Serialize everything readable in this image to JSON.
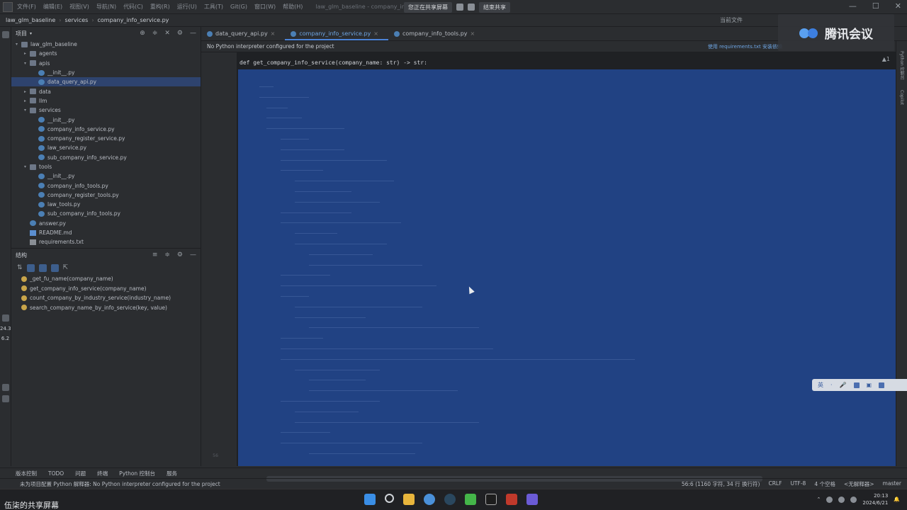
{
  "menubar": {
    "items": [
      "文件(F)",
      "编辑(E)",
      "视图(V)",
      "导航(N)",
      "代码(C)",
      "重构(R)",
      "运行(U)",
      "工具(T)",
      "Git(G)",
      "窗口(W)",
      "帮助(H)"
    ],
    "window_title": "law_glm_baseline - company_info_se",
    "share_pill": "您正在共享屏幕",
    "stop_share": "结束共享"
  },
  "navbar": {
    "project": "law_glm_baseline",
    "folder": "services",
    "file": "company_info_service.py",
    "run_config": "当前文件"
  },
  "project_panel": {
    "title": "项目",
    "tree": [
      {
        "label": "law_glm_baseline",
        "level": 0,
        "type": "folder",
        "expanded": true
      },
      {
        "label": "agents",
        "level": 1,
        "type": "folder",
        "expanded": false
      },
      {
        "label": "apis",
        "level": 1,
        "type": "folder",
        "expanded": true
      },
      {
        "label": "__init__.py",
        "level": 2,
        "type": "py"
      },
      {
        "label": "data_query_api.py",
        "level": 2,
        "type": "py",
        "selected": true
      },
      {
        "label": "data",
        "level": 1,
        "type": "folder",
        "expanded": false
      },
      {
        "label": "llm",
        "level": 1,
        "type": "folder",
        "expanded": false
      },
      {
        "label": "services",
        "level": 1,
        "type": "folder",
        "expanded": true
      },
      {
        "label": "__init__.py",
        "level": 2,
        "type": "py"
      },
      {
        "label": "company_info_service.py",
        "level": 2,
        "type": "py"
      },
      {
        "label": "company_register_service.py",
        "level": 2,
        "type": "py"
      },
      {
        "label": "law_service.py",
        "level": 2,
        "type": "py"
      },
      {
        "label": "sub_company_info_service.py",
        "level": 2,
        "type": "py"
      },
      {
        "label": "tools",
        "level": 1,
        "type": "folder",
        "expanded": true
      },
      {
        "label": "__init__.py",
        "level": 2,
        "type": "py"
      },
      {
        "label": "company_info_tools.py",
        "level": 2,
        "type": "py"
      },
      {
        "label": "company_register_tools.py",
        "level": 2,
        "type": "py"
      },
      {
        "label": "law_tools.py",
        "level": 2,
        "type": "py"
      },
      {
        "label": "sub_company_info_tools.py",
        "level": 2,
        "type": "py"
      },
      {
        "label": "answer.py",
        "level": 1,
        "type": "py"
      },
      {
        "label": "README.md",
        "level": 1,
        "type": "md"
      },
      {
        "label": "requirements.txt",
        "level": 1,
        "type": "txt"
      }
    ]
  },
  "structure_panel": {
    "title": "结构",
    "items": [
      "_get_fu_name(company_name)",
      "get_company_info_service(company_name)",
      "count_company_by_industry_service(industry_name)",
      "search_company_name_by_info_service(key, value)"
    ]
  },
  "left_strip": {
    "val1": "24.3",
    "val2": "6.2"
  },
  "editor": {
    "tabs": [
      {
        "label": "data_query_api.py",
        "active": false
      },
      {
        "label": "company_info_service.py",
        "active": true
      },
      {
        "label": "company_info_tools.py",
        "active": false
      }
    ],
    "notice": "No Python interpreter configured for the project",
    "notice_link": "使用 requirements.txt 安装依赖",
    "code_line": "def get_company_info_service(company_name: str) -> str:",
    "inspect_badge": "▲1",
    "line_numbers": [
      "",
      "",
      "",
      "",
      "",
      "",
      "",
      "",
      "",
      "",
      "",
      "",
      "",
      "",
      "",
      "",
      "",
      "",
      "",
      "",
      "",
      "",
      "",
      "",
      "",
      "",
      "",
      "",
      "",
      "",
      "",
      "",
      "",
      "",
      "",
      "",
      "56"
    ]
  },
  "right_strip": {
    "labels": [
      "Python 控制台",
      "Copilot"
    ]
  },
  "tencent": {
    "label": "腾讯会议"
  },
  "bottom_tools": [
    "版本控制",
    "TODO",
    "问题",
    "终端",
    "Python 控制台",
    "服务"
  ],
  "status": {
    "message": "未为项目配置 Python 解释器: No Python interpreter configured for the project",
    "position": "56:6 (1160 字符, 34 行 换行符)",
    "line_sep": "CRLF",
    "encoding": "UTF-8",
    "indent": "4 个空格",
    "interpreter": "<无解释器>",
    "branch": "master"
  },
  "taskbar": {
    "share_label": "伍柒的共享屏幕",
    "time": "20:13",
    "date": "2024/6/21"
  }
}
